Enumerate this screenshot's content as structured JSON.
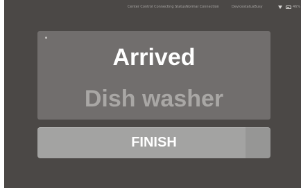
{
  "status_bar": {
    "connection_text": "Center Control Connecting StatusNormal Connection",
    "device_status_text": "DevicestatusBusy",
    "battery_percent": "46%"
  },
  "card": {
    "title": "Arrived",
    "subtitle": "Dish washer"
  },
  "actions": {
    "finish_label": "FINISH"
  },
  "colors": {
    "background": "#4b4846",
    "card": "#716e6d",
    "button": "#a3a3a2",
    "subtitle_text": "#a9a7a5"
  },
  "icons": [
    "wifi-icon",
    "battery-icon",
    "indicator-dot-icon"
  ]
}
